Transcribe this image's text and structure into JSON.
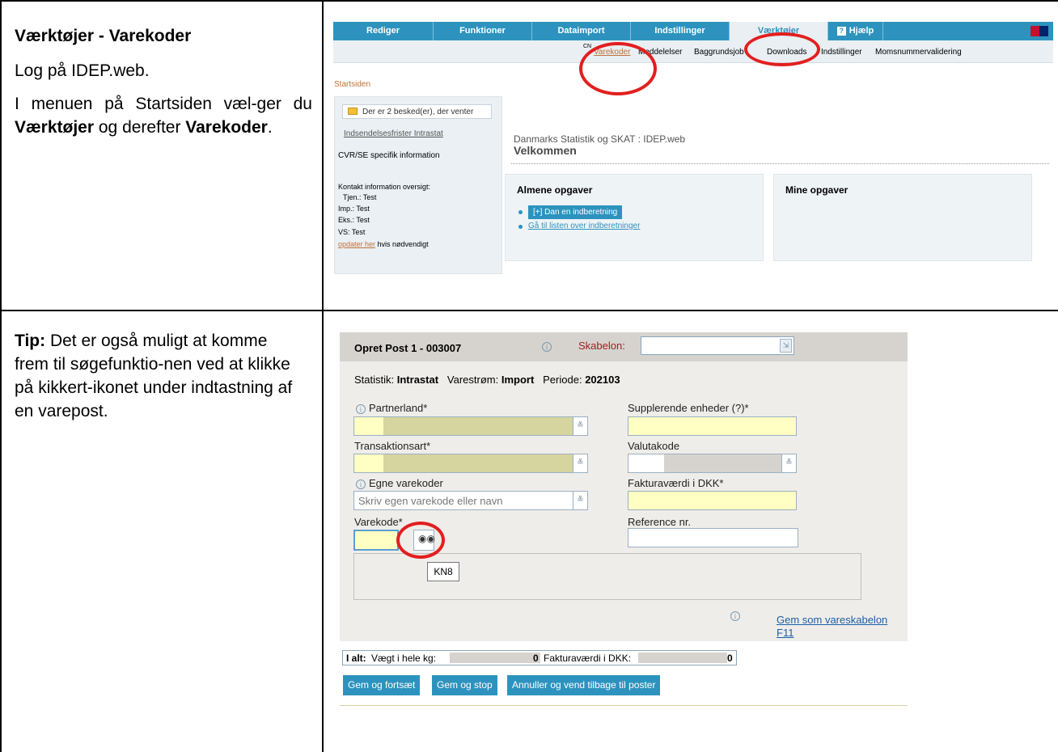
{
  "row1": {
    "heading": "Værktøjer - Varekoder",
    "para1": "Log på IDEP.web.",
    "para2_a": "I menuen på Startsiden væl-ger du ",
    "para2_b": "Værktøjer",
    "para2_c": " og derefter ",
    "para2_d": "Varekoder",
    "para2_e": "."
  },
  "row2": {
    "tip_label": "Tip:",
    "tip_text": " Det er også muligt at komme frem til søgefunktio-nen ved at klikke på kikkert-ikonet under indtastning af en varepost."
  },
  "shot1": {
    "nav": [
      "Rediger",
      "Funktioner",
      "Dataimport",
      "Indstillinger",
      "Værktøjer",
      "Hjælp"
    ],
    "subnav": {
      "cn": "CN",
      "varekoder": "Varekoder",
      "meddelelser": "Meddelelser",
      "baggrund": "Baggrundsjob",
      "downloads": "Downloads",
      "indstillinger": "Indstillinger",
      "moms": "Momsnummervalidering"
    },
    "breadcrumb": "Startsiden",
    "msg": "Der er 2 besked(er), der venter",
    "frister": "Indsendelsesfrister Intrastat",
    "cvr": "CVR/SE specifik information",
    "kontakt": "Kontakt information oversigt:",
    "tjen": "Tjen.: Test",
    "imp": "Imp.: Test",
    "eks": "Eks.: Test",
    "vs": "VS: Test",
    "opdater_link": "opdater her",
    "opdater_rest": " hvis nødvendigt",
    "welcome_sub": "Danmarks Statistik og SKAT : IDEP.web",
    "welcome_title": "Velkommen",
    "almene": "Almene opgaver",
    "dan_btn": "[+] Dan en indberetning",
    "listen_link": "Gå til listen over indberetninger",
    "mine": "Mine opgaver"
  },
  "shot2": {
    "title": "Opret Post 1 - 003007",
    "info_glyph": "i",
    "skabelon": "Skabelon:",
    "stat_label": "Statistik:",
    "stat_val": "Intrastat",
    "strom_label": "Varestrøm:",
    "strom_val": "Import",
    "periode_label": "Periode:",
    "periode_val": "202103",
    "partnerland": "Partnerland*",
    "supp": "Supplerende enheder (?)*",
    "trans": "Transaktionsart*",
    "valuta": "Valutakode",
    "egne": "Egne varekoder",
    "egne_ph": "Skriv egen varekode eller navn",
    "faktura": "Fakturaværdi i DKK*",
    "varekode": "Varekode*",
    "reference": "Reference nr.",
    "kn8": "KN8",
    "gem_link_1": "Gem som vareskabelon",
    "gem_link_2": "F11",
    "ialt": "I alt:",
    "vaegt": "Vægt i hele kg:",
    "vaegt_val": "0",
    "faktura_total": "Fakturaværdi i DKK:",
    "faktura_val": "0",
    "btn_fortsaet": "Gem og fortsæt",
    "btn_stop": "Gem og stop",
    "btn_annuller": "Annuller og vend tilbage til poster"
  },
  "colors": {
    "accent": "#2d93be",
    "highlight": "#e21f1f",
    "required_field": "#ffffc4"
  }
}
